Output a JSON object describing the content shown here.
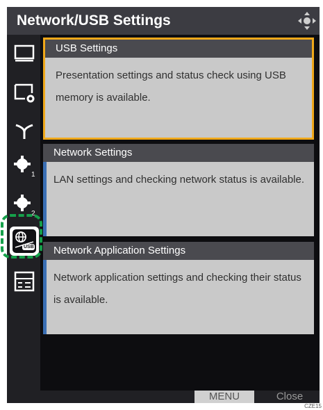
{
  "header": {
    "title": "Network/USB Settings"
  },
  "sidebar": {
    "icons": [
      "monitor-icon",
      "monitor-settings-icon",
      "antenna-icon",
      "gear-1-icon",
      "gear-2-icon",
      "network-usb-icon",
      "panel-settings-icon"
    ],
    "selected": "network-usb-icon",
    "selected_badge": "USB"
  },
  "cards": [
    {
      "title": "USB Settings",
      "description": "Presentation settings and status check using USB memory is available."
    },
    {
      "title": "Network Settings",
      "description": "LAN settings and checking network status is  available."
    },
    {
      "title": "Network Application Settings",
      "description": "Network application settings and checking their status is available."
    }
  ],
  "footer": {
    "menu_label": "MENU",
    "close_label": "Close"
  },
  "figure_code": "CZE15",
  "colors": {
    "accent": "#f0a81a",
    "card_bar": "#3a6fb4",
    "highlight": "#15a04a"
  }
}
